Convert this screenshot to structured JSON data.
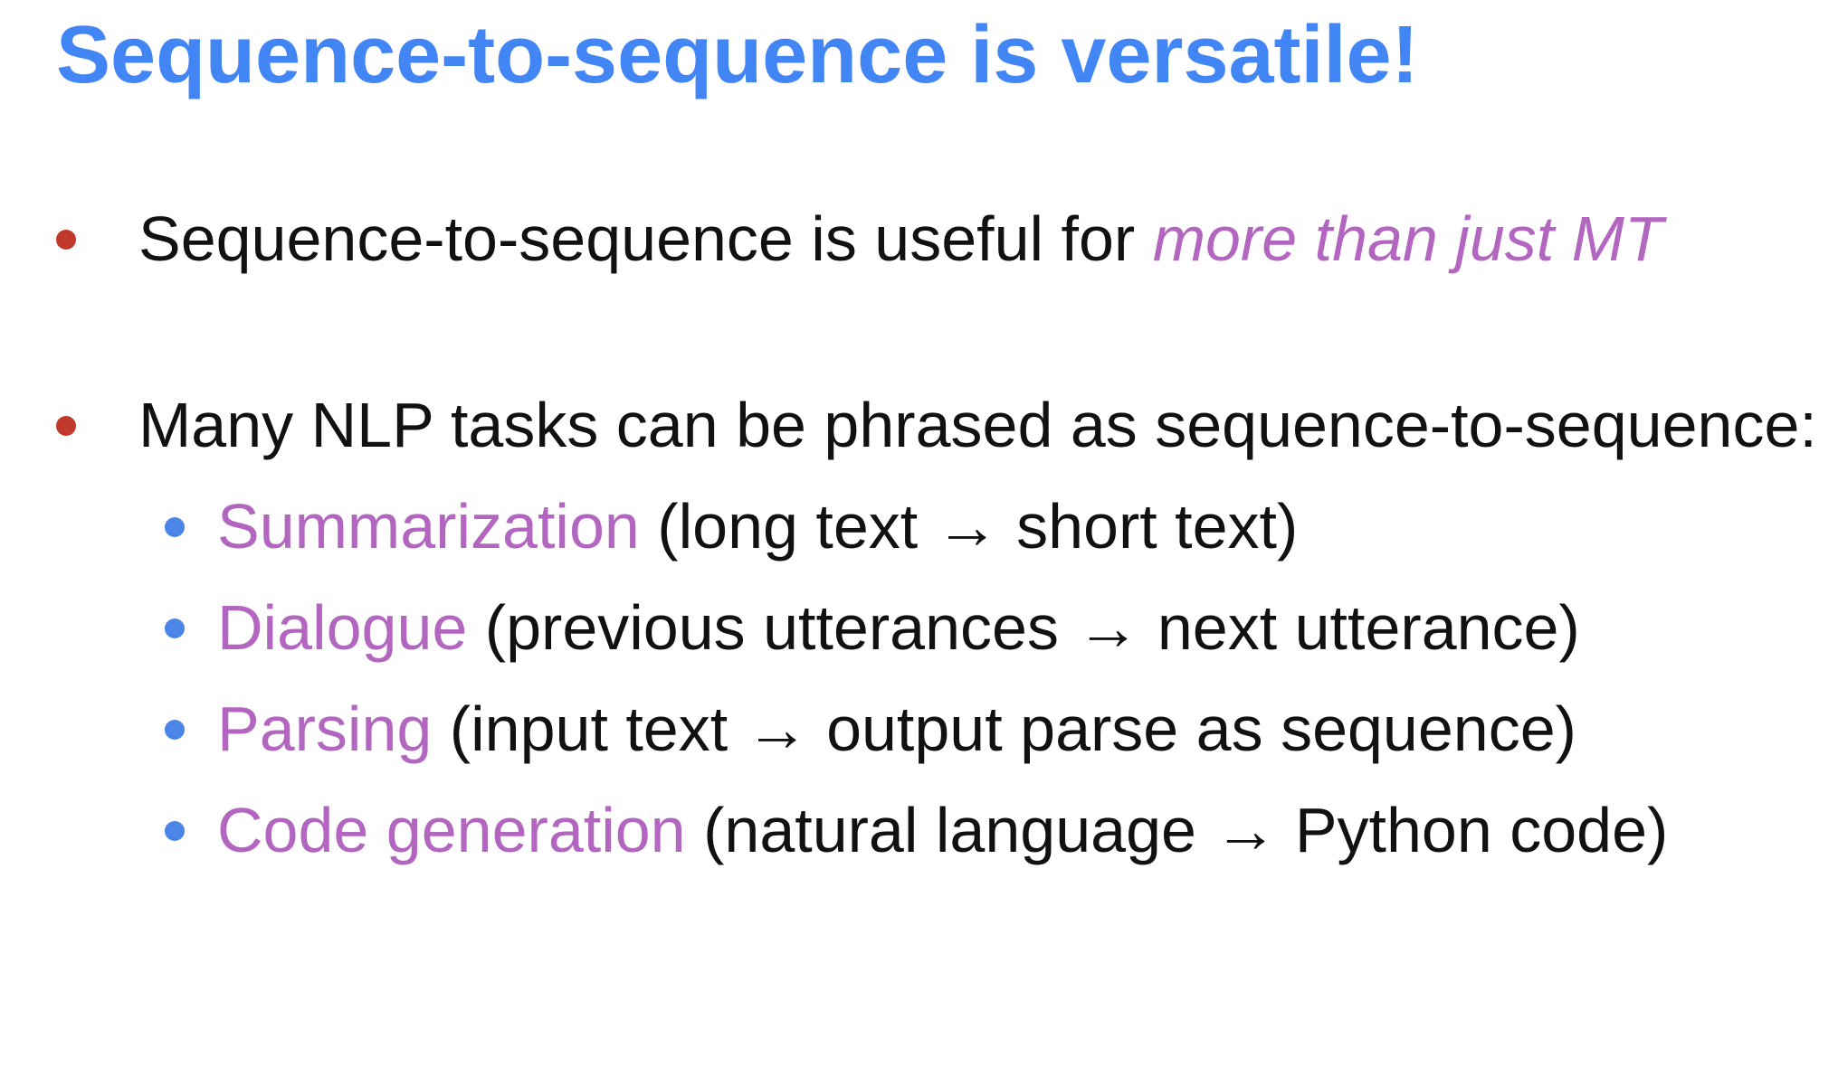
{
  "slide": {
    "title": "Sequence-to-sequence is versatile!",
    "bullets": [
      {
        "text": "Sequence-to-sequence is useful for ",
        "emphasis": "more than just MT"
      },
      {
        "text": "Many NLP tasks can be phrased as sequence-to-sequence:"
      }
    ],
    "subbullets": [
      {
        "term": "Summarization",
        "detail": " (long text → short text)"
      },
      {
        "term": "Dialogue",
        "detail": " (previous utterances → next utterance)"
      },
      {
        "term": "Parsing",
        "detail": " (input text → output parse as sequence)"
      },
      {
        "term": "Code generation",
        "detail": " (natural language → Python code)"
      }
    ]
  },
  "colors": {
    "title": "#4285f4",
    "accent": "#b366c0",
    "main_bullet": "#c0392b",
    "sub_bullet": "#4a86e8",
    "text": "#111111"
  }
}
